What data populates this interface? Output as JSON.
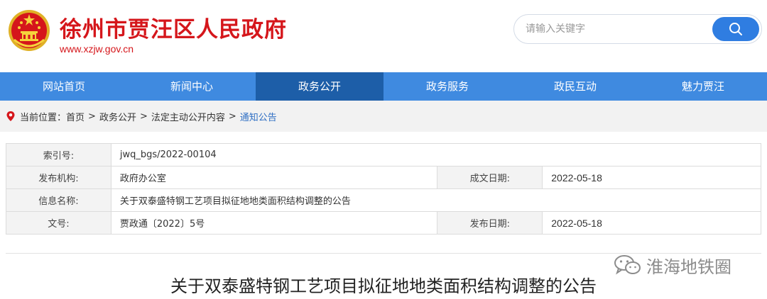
{
  "header": {
    "site_title": "徐州市贾汪区人民政府",
    "site_url": "www.xzjw.gov.cn",
    "search_placeholder": "请输入关键字",
    "emblem": "national-emblem"
  },
  "nav": {
    "items": [
      {
        "label": "网站首页",
        "active": false
      },
      {
        "label": "新闻中心",
        "active": false
      },
      {
        "label": "政务公开",
        "active": true
      },
      {
        "label": "政务服务",
        "active": false
      },
      {
        "label": "政民互动",
        "active": false
      },
      {
        "label": "魅力贾汪",
        "active": false
      }
    ]
  },
  "breadcrumb": {
    "prefix": "当前位置：",
    "items": [
      "首页",
      "政务公开",
      "法定主动公开内容"
    ],
    "separator": ">",
    "current": "通知公告"
  },
  "info": {
    "index_label": "索引号:",
    "index_value": "jwq_bgs/2022-00104",
    "org_label": "发布机构:",
    "org_value": "政府办公室",
    "written_date_label": "成文日期:",
    "written_date_value": "2022-05-18",
    "name_label": "信息名称:",
    "name_value": "关于双泰盛特钢工艺项目拟征地地类面积结构调整的公告",
    "doc_no_label": "文号:",
    "doc_no_value": "贾政通〔2022〕5号",
    "publish_date_label": "发布日期:",
    "publish_date_value": "2022-05-18"
  },
  "article": {
    "title": "关于双泰盛特钢工艺项目拟征地地类面积结构调整的公告"
  },
  "watermark": {
    "text": "淮海地铁圈",
    "icon": "wechat-icon"
  },
  "colors": {
    "brand_red": "#d5161b",
    "nav_blue": "#3f8ae0",
    "nav_active": "#1d5ea8",
    "search_blue": "#2f7de1",
    "link_blue": "#2f6fc4"
  }
}
